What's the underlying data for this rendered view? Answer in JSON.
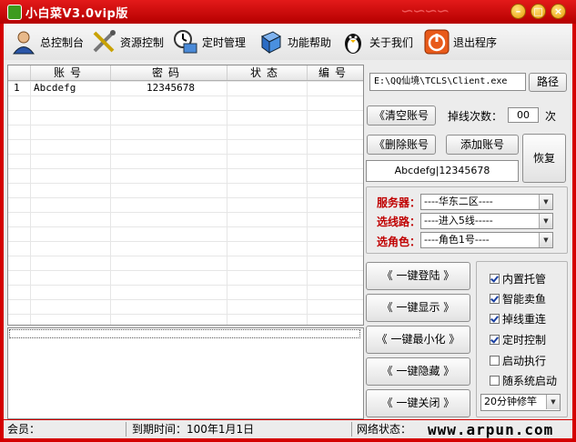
{
  "window": {
    "title": "小白菜V3.0vip版",
    "accent": "#d40000"
  },
  "toolbar": {
    "items": [
      {
        "label": "总控制台",
        "icon": "user-icon"
      },
      {
        "label": "资源控制",
        "icon": "tools-icon"
      },
      {
        "label": "定时管理",
        "icon": "clock-icon"
      },
      {
        "label": "功能帮助",
        "icon": "help-book-icon"
      },
      {
        "label": "关于我们",
        "icon": "penguin-icon"
      },
      {
        "label": "退出程序",
        "icon": "power-icon"
      }
    ]
  },
  "grid": {
    "columns": [
      "账号",
      "密码",
      "状态",
      "编号"
    ],
    "rows": [
      {
        "index": "1",
        "account": "Abcdefg",
        "password": "12345678",
        "status": "",
        "number": ""
      }
    ]
  },
  "right": {
    "path_value": "E:\\QQ仙境\\TCLS\\Client.exe",
    "path_button": "路径",
    "clear_button": "《清空账号",
    "drop_label": "掉线次数：",
    "drop_value": "00",
    "drop_unit": "次",
    "delete_button": "《删除账号",
    "add_button": "添加账号",
    "restore_button": "恢复",
    "account_preview": "Abcdefg|12345678",
    "server_label": "服务器：",
    "server_value": "----华东二区----",
    "line_label": "选线路：",
    "line_value": "----进入5线-----",
    "role_label": "选角色：",
    "role_value": "----角色1号----",
    "actions": [
      "《 一键登陆 》",
      "《 一键显示 》",
      "《 一键最小化 》",
      "《 一键隐藏 》",
      "《 一键关闭 》"
    ],
    "checks": [
      {
        "label": "内置托管",
        "checked": true
      },
      {
        "label": "智能卖鱼",
        "checked": true
      },
      {
        "label": "掉线重连",
        "checked": true
      },
      {
        "label": "定时控制",
        "checked": true
      },
      {
        "label": "启动执行",
        "checked": false
      },
      {
        "label": "随系统启动",
        "checked": false
      }
    ],
    "fish_rod": "20分钟修竿"
  },
  "status": {
    "member": "会员：",
    "expire": "到期时间：100年1月1日",
    "network": "网络状态："
  },
  "watermark": "www.arpun.com"
}
